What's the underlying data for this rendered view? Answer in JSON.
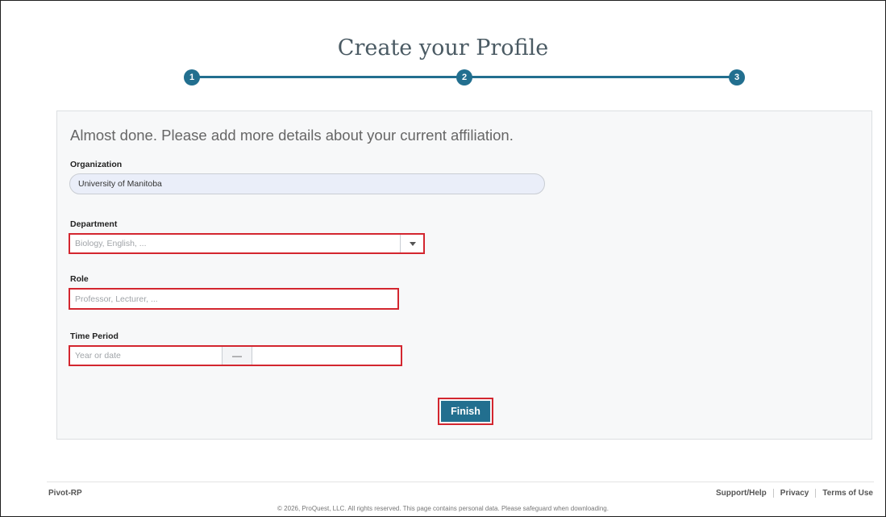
{
  "page": {
    "title": "Create your Profile"
  },
  "stepper": {
    "steps": [
      "1",
      "2",
      "3"
    ],
    "accent": "#226f8f"
  },
  "form": {
    "heading": "Almost done. Please add more details about your current affiliation.",
    "organization": {
      "label": "Organization",
      "value": "University of Manitoba"
    },
    "department": {
      "label": "Department",
      "placeholder": "Biology, English, ..."
    },
    "role": {
      "label": "Role",
      "placeholder": "Professor, Lecturer, ..."
    },
    "time_period": {
      "label": "Time Period",
      "start_placeholder": "Year or date",
      "separator": "—"
    },
    "finish_label": "Finish",
    "highlight_color": "#d3262f"
  },
  "footer": {
    "brand": "Pivot-RP",
    "links": [
      "Support/Help",
      "Privacy",
      "Terms of Use"
    ],
    "copyright": "© 2026, ProQuest, LLC. All rights reserved.   This page contains personal data. Please safeguard when downloading."
  }
}
